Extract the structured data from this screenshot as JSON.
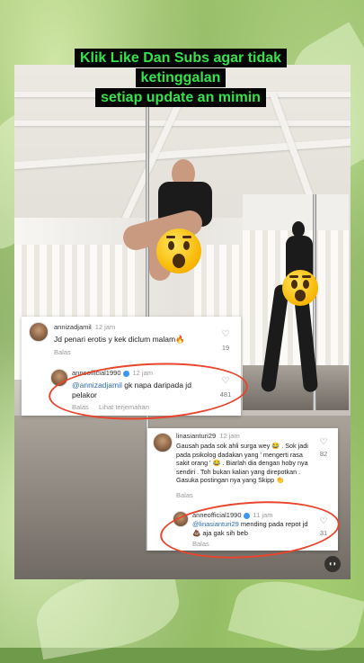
{
  "banner": {
    "line1": "Klik Like Dan Subs agar tidak ketinggalan",
    "line2": "setiap update an mimin"
  },
  "comment1": {
    "username": "annizadjamil",
    "time": "12 jam",
    "text": "Jd penari erotis y kek diclum malam🔥",
    "reply_label": "Balas",
    "likes": "19",
    "reply": {
      "username": "anneofficial1990",
      "time": "12 jam",
      "mention": "@annizadjamil",
      "text": " gk napa daripada jd pelakor",
      "reply_label": "Balas",
      "translate_label": "Lihat terjemahan",
      "likes": "481"
    }
  },
  "comment2": {
    "username": "linasianturi29",
    "time": "12 jam",
    "text": "Gausah pada sok ahli surga wey 😂 . Sok jadi pada psikolog dadakan yang ' mengerti rasa sakit orang ' 😂 . Biarlah dia dengan hoby nya sendiri . Toh bukan kalian yang direpotkan . Gasuka postingan nya yang Skipp 👏",
    "reply_label": "Balas",
    "likes": "82",
    "reply": {
      "username": "anneofficial1990",
      "time": "11 jam",
      "mention": "@linasianturi29",
      "text": " mending pada repot jd 💩 aja gak sih beb",
      "reply_label": "Balas",
      "likes": "31"
    }
  },
  "icons": {
    "heart": "heart-icon",
    "verified": "verified-badge-icon",
    "watermark": "watermark-icon"
  },
  "colors": {
    "banner_text": "#36e24a",
    "banner_bg": "#050505",
    "ring": "#e8452c",
    "mention": "#2b6cb0"
  }
}
